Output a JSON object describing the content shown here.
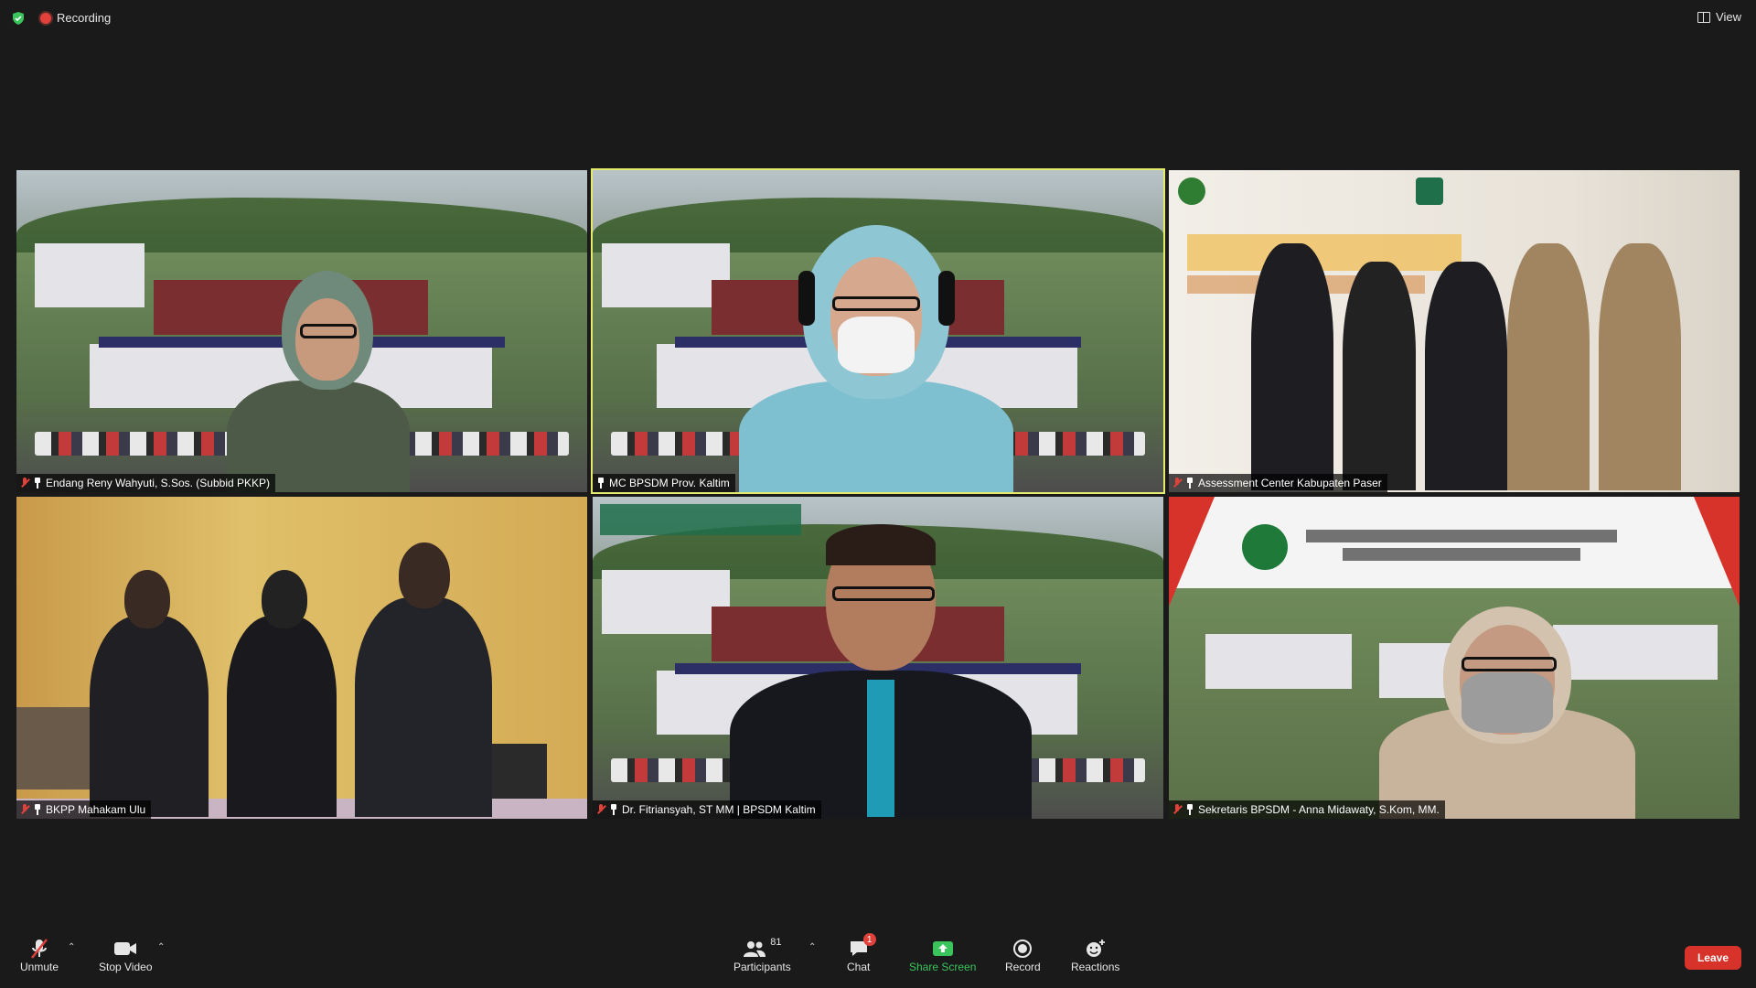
{
  "topbar": {
    "recording_label": "Recording",
    "view_label": "View",
    "security_icon": "shield-check-icon",
    "recording_icon": "record-dot-icon",
    "view_icon": "grid-view-icon"
  },
  "participants": [
    {
      "name": "Endang Reny Wahyuti, S.Sos. (Subbid PKKP)",
      "muted": true,
      "active_speaker": false
    },
    {
      "name": "MC BPSDM Prov. Kaltim",
      "muted": false,
      "active_speaker": true
    },
    {
      "name": "Assessment Center Kabupaten Paser",
      "muted": true,
      "active_speaker": false
    },
    {
      "name": "BKPP Mahakam Ulu",
      "muted": true,
      "active_speaker": false
    },
    {
      "name": "Dr. Fitriansyah, ST MM | BPSDM Kaltim",
      "muted": true,
      "active_speaker": false
    },
    {
      "name": "Sekretaris BPSDM -  Anna Midawaty, S.Kom, MM.",
      "muted": true,
      "active_speaker": false
    }
  ],
  "toolbar": {
    "unmute_label": "Unmute",
    "stop_video_label": "Stop Video",
    "participants_label": "Participants",
    "participants_count": "81",
    "chat_label": "Chat",
    "chat_badge": "1",
    "share_screen_label": "Share Screen",
    "record_label": "Record",
    "reactions_label": "Reactions",
    "leave_label": "Leave"
  },
  "colors": {
    "background": "#1a1a1a",
    "active_speaker_border": "#e6ea6b",
    "muted_red": "#e0413a",
    "share_green": "#3ac45b",
    "leave_red": "#d8332a"
  }
}
